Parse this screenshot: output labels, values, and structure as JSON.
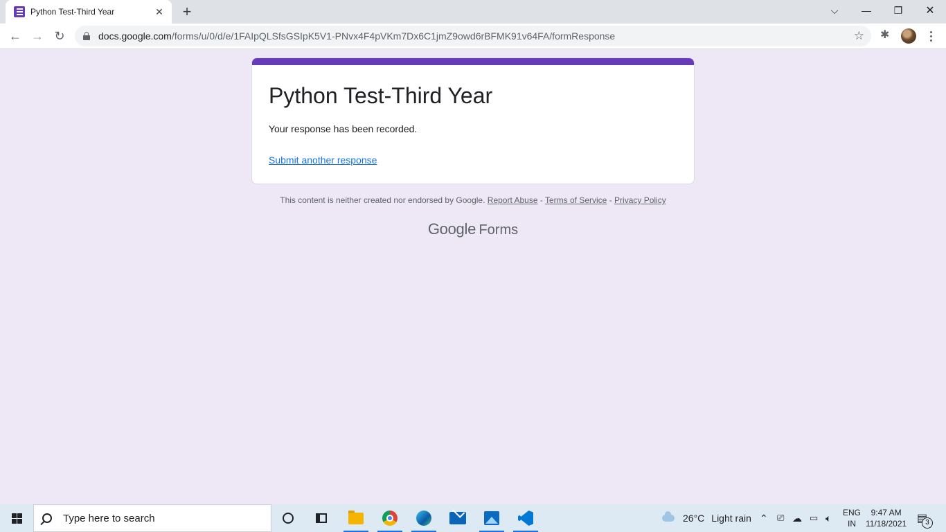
{
  "browser": {
    "tab": {
      "title": "Python Test-Third Year",
      "favicon_icon": "google-forms-icon"
    },
    "url_host": "docs.google.com",
    "url_path": "/forms/u/0/d/e/1FAIpQLSfsGSIpK5V1-PNvx4F4pVKm7Dx6C1jmZ9owd6rBFMK91v64FA/formResponse",
    "window_controls": [
      "minimize",
      "restore",
      "close"
    ]
  },
  "form": {
    "title": "Python Test-Third Year",
    "confirmation": "Your response has been recorded.",
    "submit_another": "Submit another response",
    "accent_color": "#673ab7"
  },
  "footer": {
    "disclaimer": "This content is neither created nor endorsed by Google.",
    "report_abuse": "Report Abuse",
    "separator": "-",
    "terms": "Terms of Service",
    "privacy": "Privacy Policy",
    "brand_google": "Google",
    "brand_forms": "Forms"
  },
  "taskbar": {
    "search_placeholder": "Type here to search",
    "weather_temp": "26°C",
    "weather_text": "Light rain",
    "lang_primary": "ENG",
    "lang_secondary": "IN",
    "time": "9:47 AM",
    "date": "11/18/2021",
    "notification_count": "3",
    "pinned_apps": [
      "cortana",
      "task-view",
      "file-explorer",
      "chrome",
      "edge",
      "mail",
      "photos",
      "vscode"
    ]
  }
}
